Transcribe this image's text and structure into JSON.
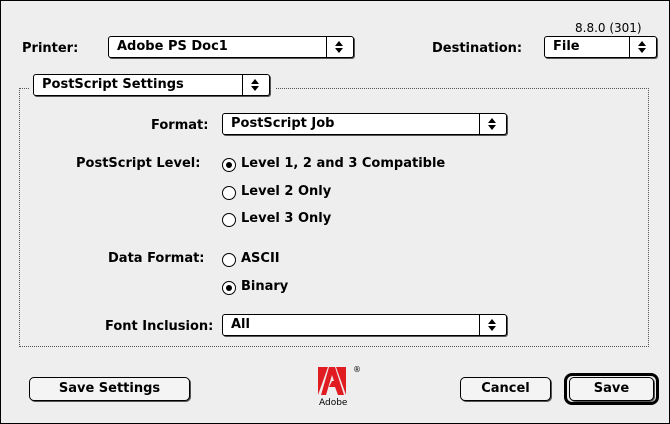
{
  "version": "8.8.0 (301)",
  "printer": {
    "label": "Printer:",
    "value": "Adobe PS Doc1"
  },
  "destination": {
    "label": "Destination:",
    "value": "File"
  },
  "panel_selector": {
    "value": "PostScript Settings"
  },
  "format": {
    "label": "Format:",
    "value": "PostScript Job"
  },
  "postscript_level": {
    "label": "PostScript Level:",
    "options": [
      {
        "label": "Level 1, 2 and 3 Compatible",
        "selected": true
      },
      {
        "label": "Level 2 Only",
        "selected": false
      },
      {
        "label": "Level 3 Only",
        "selected": false
      }
    ]
  },
  "data_format": {
    "label": "Data Format:",
    "options": [
      {
        "label": "ASCII",
        "selected": false
      },
      {
        "label": "Binary",
        "selected": true
      }
    ]
  },
  "font_inclusion": {
    "label": "Font Inclusion:",
    "value": "All"
  },
  "buttons": {
    "save_settings": "Save Settings",
    "cancel": "Cancel",
    "save": "Save"
  },
  "logo": {
    "brand": "Adobe",
    "mark": "®",
    "color": "#e11b22"
  }
}
